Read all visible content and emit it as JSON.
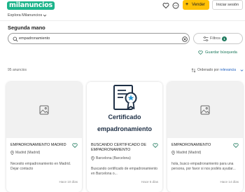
{
  "header": {
    "logo": "milanuncios",
    "sell_label": "Vender",
    "login_label": "Iniciar sesión"
  },
  "explore_label": "Explora Milanuncios",
  "page_title": "Segunda mano",
  "search": {
    "value": "empadronamiento",
    "filters_label": "Filtros",
    "filters_count": "1"
  },
  "save_search_label": "Guardar búsqueda",
  "results_count": "95 anuncios",
  "sort": {
    "label": "Ordenado por",
    "value": "relevancia"
  },
  "cards": [
    {
      "title": "EMPADRONAMIENTO MADRID",
      "location": "Madrid (Madrid)",
      "description": "Necesito empadronamiento en Madrid. Dejar contacto",
      "time": "Hace 10 días"
    },
    {
      "image_text_1": "Certificado",
      "image_text_2": "empadronamiento",
      "title": "BUSCANDO CERTIFICADO DE EMPADRONAMIENTO",
      "location": "Barcelona (Barcelona)",
      "description": "Buscando certificado de empadronamiento en Barcelona o...",
      "time": "Hace 5 días"
    },
    {
      "title": "EMPADRONAMIENTO",
      "location": "Madrid (Madrid)",
      "description": "hola, busco empadronamiento para una persona, por favor si nos podéis ayudar...",
      "time": "Hace 14 días"
    }
  ],
  "colors": {
    "brand": "#1bb38a",
    "accent": "#1f7a5e",
    "sell_button": "#ffc107"
  },
  "icons": [
    "heart-icon",
    "chat-icon",
    "plus-icon",
    "chevron-down-icon",
    "search-icon",
    "clear-icon",
    "filter-icon",
    "sort-icon",
    "location-pin-icon",
    "image-placeholder-icon",
    "certificate-icon"
  ]
}
